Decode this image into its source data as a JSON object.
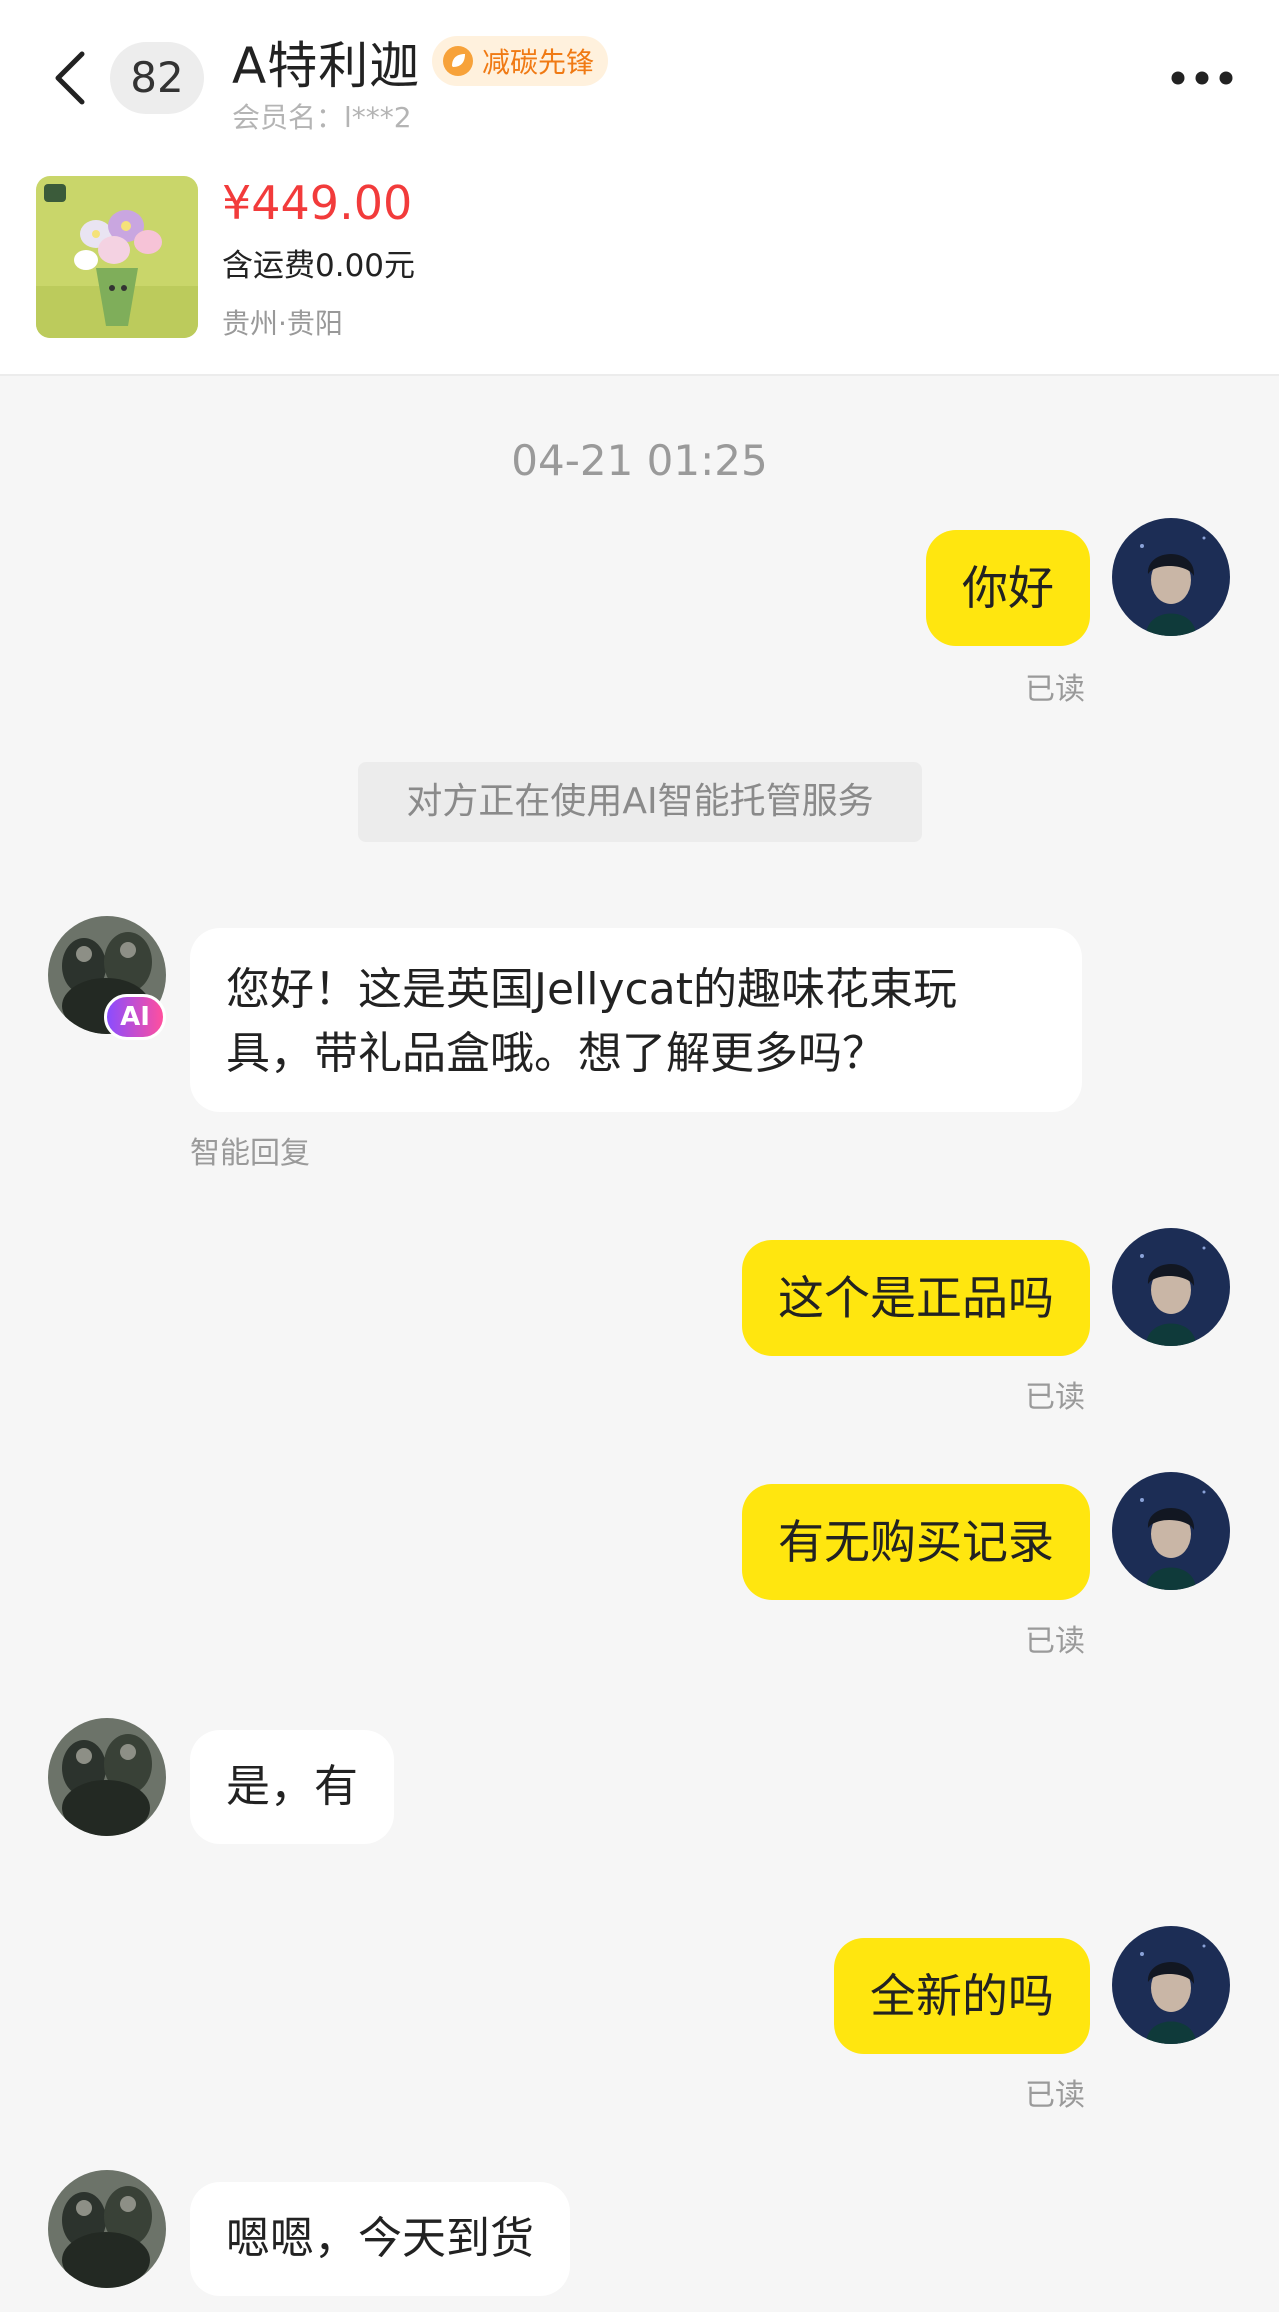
{
  "header": {
    "unread_count": "82",
    "shop_name": "A特利迦",
    "badge_label": "减碳先锋",
    "member_label": "会员名：l***2",
    "icons": [
      "back-arrow-icon",
      "more-icon",
      "leaf-icon"
    ]
  },
  "product": {
    "price": "¥449.00",
    "shipping": "含运费0.00元",
    "location": "贵州·贵阳",
    "price_color": "#f23b3b"
  },
  "chat": {
    "timestamp": "04-21 01:25",
    "system_notice": "对方正在使用AI智能托管服务",
    "ai_tag": "AI",
    "smart_reply_label": "智能回复",
    "messages": [
      {
        "from": "me",
        "text": "你好",
        "status": "已读"
      },
      {
        "from": "shop",
        "line1": "您好！这是英国Jellycat的趣味花束玩",
        "line2": "具，带礼品盒哦。想了解更多吗？"
      },
      {
        "from": "me",
        "text": "这个是正品吗",
        "status": "已读"
      },
      {
        "from": "me",
        "text": "有无购买记录",
        "status": "已读"
      },
      {
        "from": "shop",
        "text": "是，有"
      },
      {
        "from": "me",
        "text": "全新的吗",
        "status": "已读"
      },
      {
        "from": "shop",
        "text": "嗯嗯，今天到货"
      }
    ]
  },
  "colors": {
    "my_bubble": "#ffe60f",
    "shop_bubble": "#ffffff",
    "background": "#f6f6f6",
    "badge_orange": "#f07a14"
  }
}
